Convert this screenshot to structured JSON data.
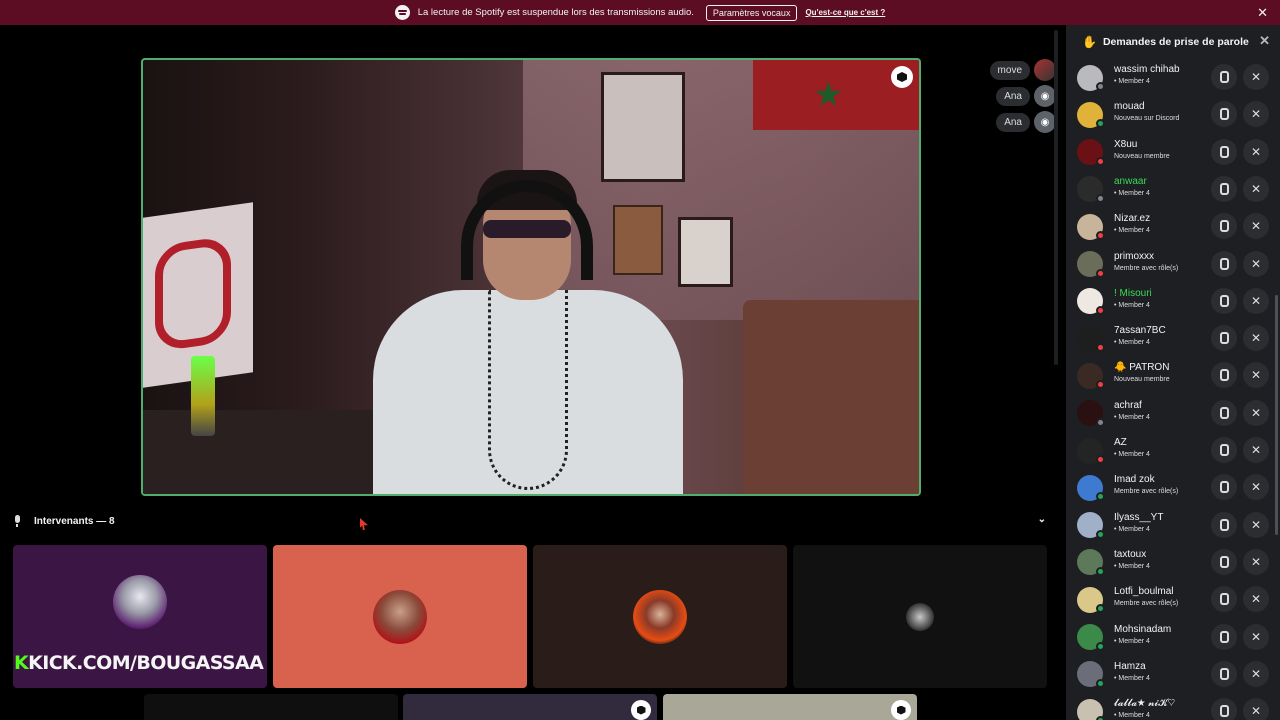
{
  "banner": {
    "message": "La lecture de Spotify est suspendue lors des transmissions audio.",
    "settings_button": "Paramètres vocaux",
    "help_link": "Qu'est-ce que c'est ?",
    "close": "✕"
  },
  "side_users": [
    {
      "name": "move"
    },
    {
      "name": "Ana"
    },
    {
      "name": "Ana"
    }
  ],
  "speakers": {
    "header": "Intervenants — 8",
    "chevron": "⌄",
    "kick_prefix": "K",
    "kick_text": "KICK.COM/BOUGASSAA"
  },
  "panel": {
    "title": "Demandes de prise de parole",
    "close": "✕",
    "requests": [
      {
        "name": "wassim chihab",
        "sub": "• Member 4",
        "color": "#b9b9be",
        "status": "#80848e"
      },
      {
        "name": "mouad",
        "sub": "Nouveau sur Discord",
        "color": "#e0b23a",
        "status": "#23a55a"
      },
      {
        "name": "X8uu",
        "sub": "Nouveau membre",
        "color": "#6b1115",
        "status": "#f23f43"
      },
      {
        "name": "anwaar",
        "sub": "• Member 4",
        "color": "#2b2b2b",
        "status": "#80848e",
        "green": true
      },
      {
        "name": "Nizar.ez",
        "sub": "• Member 4",
        "color": "#c8b49a",
        "status": "#f23f43"
      },
      {
        "name": "primoxxx",
        "sub": "Membre avec rôle(s)",
        "color": "#6a6d5a",
        "status": "#f23f43"
      },
      {
        "name": "! Misouri",
        "sub": "• Member 4",
        "color": "#efe8e2",
        "status": "#f23f43",
        "green": true
      },
      {
        "name": "7assan7BC",
        "sub": "• Member 4",
        "color": "#1e1e1e",
        "status": "#f23f43"
      },
      {
        "name": "🐥 PATRON",
        "sub": "Nouveau membre",
        "color": "#3b2a24",
        "status": "#f23f43"
      },
      {
        "name": "achraf",
        "sub": "• Member 4",
        "color": "#2a1010",
        "status": "#80848e"
      },
      {
        "name": "AZ",
        "sub": "• Member 4",
        "color": "#242424",
        "status": "#f23f43"
      },
      {
        "name": "Imad zok",
        "sub": "Membre avec rôle(s)",
        "color": "#3d7ad0",
        "status": "#23a55a"
      },
      {
        "name": "Ilyass__YT",
        "sub": "• Member 4",
        "color": "#9fb0c8",
        "status": "#23a55a"
      },
      {
        "name": "taxtoux",
        "sub": "• Member 4",
        "color": "#5c7a5a",
        "status": "#23a55a"
      },
      {
        "name": "Lotfi_boulmal",
        "sub": "Membre avec rôle(s)",
        "color": "#d9c88a",
        "status": "#23a55a"
      },
      {
        "name": "Mohsinadam",
        "sub": "• Member 4",
        "color": "#3b8a4a",
        "status": "#23a55a"
      },
      {
        "name": "Hamza",
        "sub": "• Member 4",
        "color": "#6b6e78",
        "status": "#23a55a"
      },
      {
        "name": "𝓵𝓪𝓵𝓵𝓪★ 𝓷𝓲𝓚♡",
        "sub": "• Member 4",
        "color": "#c8c0b0",
        "status": "#23a55a"
      }
    ]
  }
}
